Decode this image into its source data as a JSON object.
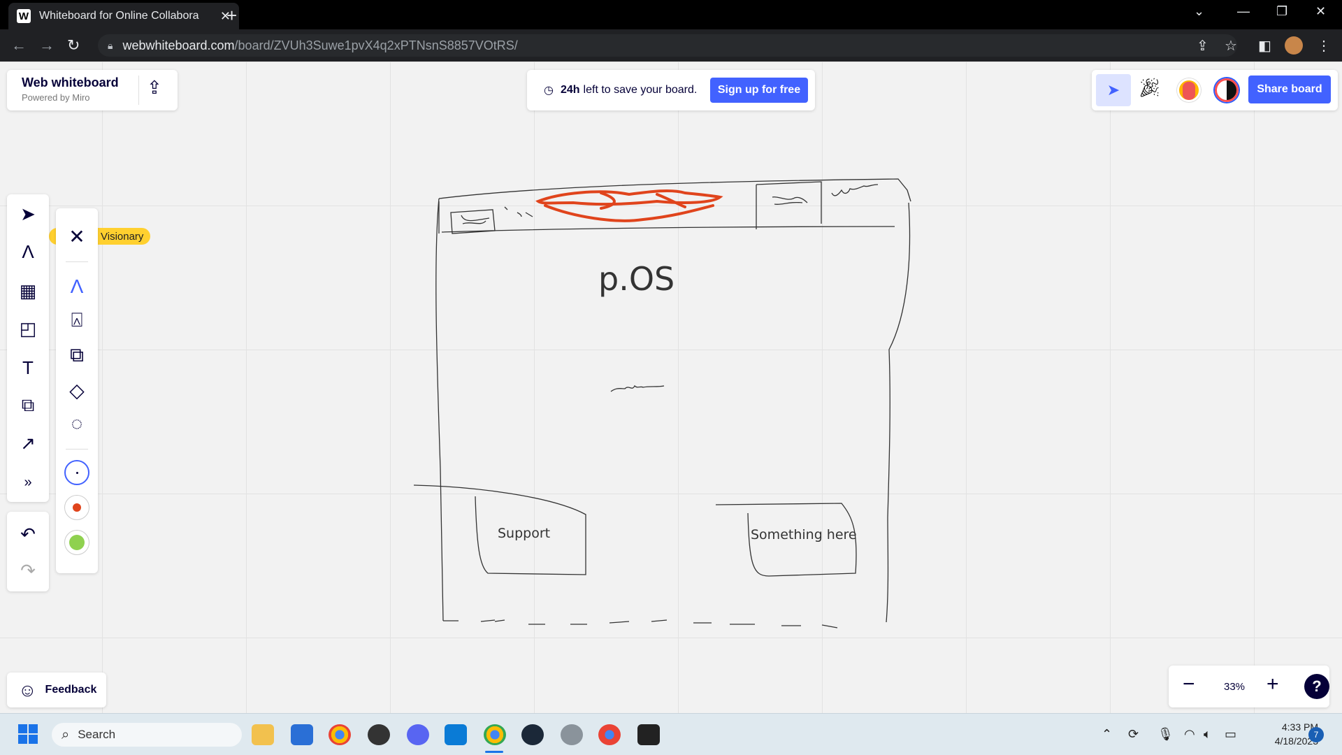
{
  "browser": {
    "tab_title": "Whiteboard for Online Collabora",
    "favicon_letter": "W",
    "url_host": "webwhiteboard.com",
    "url_path": "/board/ZVUh3Suwe1pvX4q2xPTNsnS8857VOtRS/"
  },
  "header": {
    "brand_title": "Web whiteboard",
    "brand_subtitle": "Powered by Miro",
    "save_hours": "24h",
    "save_text": "left to save your board.",
    "signup_label": "Sign up for free",
    "share_label": "Share board"
  },
  "canvas": {
    "sticker_label": "Visionary",
    "sketch_title": "p.OS",
    "sketch_button_left": "Support",
    "sketch_button_right": "Something here"
  },
  "bottom": {
    "feedback_label": "Feedback",
    "zoom_level": "33%",
    "help_label": "?"
  },
  "taskbar": {
    "search_placeholder": "Search",
    "time": "4:33 PM",
    "date": "4/18/2023",
    "notification_count": "7"
  },
  "colors": {
    "accent": "#4262ff",
    "sketch_red": "#e0441c",
    "sticker": "#ffd02f",
    "swatch_red": "#e0441c",
    "swatch_green": "#8fd14f"
  }
}
